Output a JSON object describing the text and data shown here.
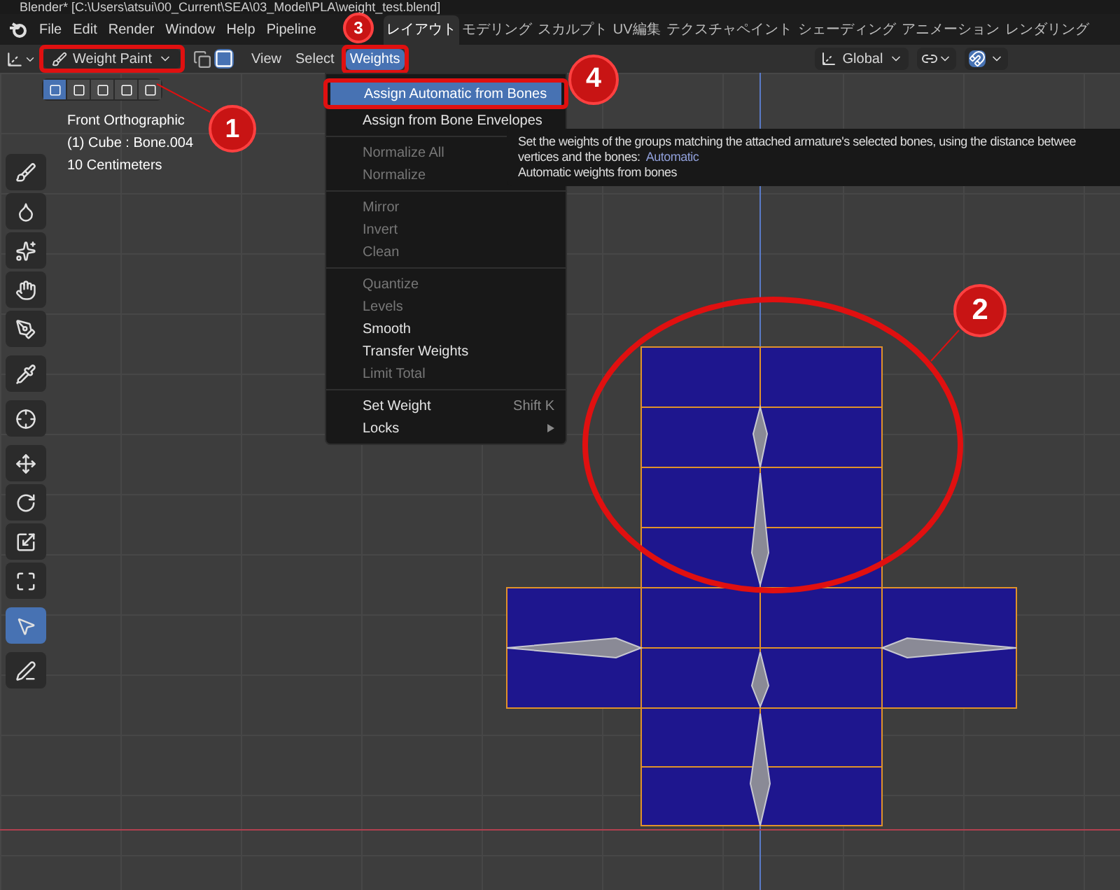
{
  "window": {
    "title": "Blender* [C:\\Users\\atsui\\00_Current\\SEA\\03_Model\\PLA\\weight_test.blend]"
  },
  "menu_bar": [
    "File",
    "Edit",
    "Render",
    "Window",
    "Help",
    "Pipeline"
  ],
  "workspace_tabs": [
    {
      "label": "レイアウト",
      "selected": true
    },
    {
      "label": "モデリング",
      "selected": false
    },
    {
      "label": "スカルプト",
      "selected": false
    },
    {
      "label": "UV編集",
      "selected": false
    },
    {
      "label": "テクスチャペイント",
      "selected": false
    },
    {
      "label": "シェーディング",
      "selected": false
    },
    {
      "label": "アニメーション",
      "selected": false
    },
    {
      "label": "レンダリング",
      "selected": false
    }
  ],
  "header": {
    "mode": "Weight Paint",
    "mode_highlighted": true,
    "menus": [
      {
        "label": "View",
        "selected": false,
        "highlighted": false
      },
      {
        "label": "Select",
        "selected": false,
        "highlighted": false
      },
      {
        "label": "Weights",
        "selected": true,
        "highlighted": true
      }
    ],
    "orientation": "Global"
  },
  "select_modes": [
    {
      "selected": true
    },
    {
      "selected": false
    },
    {
      "selected": false
    },
    {
      "selected": false
    },
    {
      "selected": false
    }
  ],
  "viewport_info": [
    "Front Orthographic",
    "(1) Cube : Bone.004",
    "10 Centimeters"
  ],
  "toolbar": [
    [
      {
        "kind": "brush",
        "selected": false
      },
      {
        "kind": "drop",
        "selected": false
      },
      {
        "kind": "blur",
        "selected": false
      },
      {
        "kind": "smear",
        "selected": false
      },
      {
        "kind": "gradient",
        "selected": false
      }
    ],
    [
      {
        "kind": "sample",
        "selected": false
      }
    ],
    [
      {
        "kind": "cursor",
        "selected": false
      }
    ],
    [
      {
        "kind": "move",
        "selected": false
      },
      {
        "kind": "rotate",
        "selected": false
      },
      {
        "kind": "scale",
        "selected": false
      },
      {
        "kind": "transform",
        "selected": false
      }
    ],
    [
      {
        "kind": "select",
        "selected": true
      }
    ],
    [
      {
        "kind": "annotate",
        "selected": false
      }
    ]
  ],
  "weights_menu": [
    [
      {
        "label": "Assign Automatic from Bones",
        "selected": true,
        "disabled": false,
        "highlighted": true
      },
      {
        "label": "Assign from Bone Envelopes",
        "selected": false,
        "disabled": false,
        "highlighted": false
      }
    ],
    [
      {
        "label": "Normalize All",
        "selected": false,
        "disabled": true,
        "highlighted": false
      },
      {
        "label": "Normalize",
        "selected": false,
        "disabled": true,
        "highlighted": false
      }
    ],
    [
      {
        "label": "Mirror",
        "selected": false,
        "disabled": true,
        "highlighted": false
      },
      {
        "label": "Invert",
        "selected": false,
        "disabled": true,
        "highlighted": false
      },
      {
        "label": "Clean",
        "selected": false,
        "disabled": true,
        "highlighted": false
      }
    ],
    [
      {
        "label": "Quantize",
        "selected": false,
        "disabled": true,
        "highlighted": false
      },
      {
        "label": "Levels",
        "selected": false,
        "disabled": true,
        "highlighted": false
      },
      {
        "label": "Smooth",
        "selected": false,
        "disabled": false,
        "highlighted": false
      },
      {
        "label": "Transfer Weights",
        "selected": false,
        "disabled": false,
        "highlighted": false
      },
      {
        "label": "Limit Total",
        "selected": false,
        "disabled": true,
        "highlighted": false
      }
    ],
    [
      {
        "label": "Set Weight",
        "shortcut": "Shift K",
        "selected": false,
        "disabled": false,
        "highlighted": false
      },
      {
        "label": "Locks",
        "submenu": true,
        "selected": false,
        "disabled": false,
        "highlighted": false
      }
    ]
  ],
  "tooltip": {
    "description": "Set the weights of the groups matching the attached armature's selected bones, using the distance betwee",
    "description_end": "vertices and the bones:",
    "value": "Automatic",
    "python": "Automatic weights from bones"
  },
  "annotations": [
    "1",
    "2",
    "3",
    "4"
  ]
}
